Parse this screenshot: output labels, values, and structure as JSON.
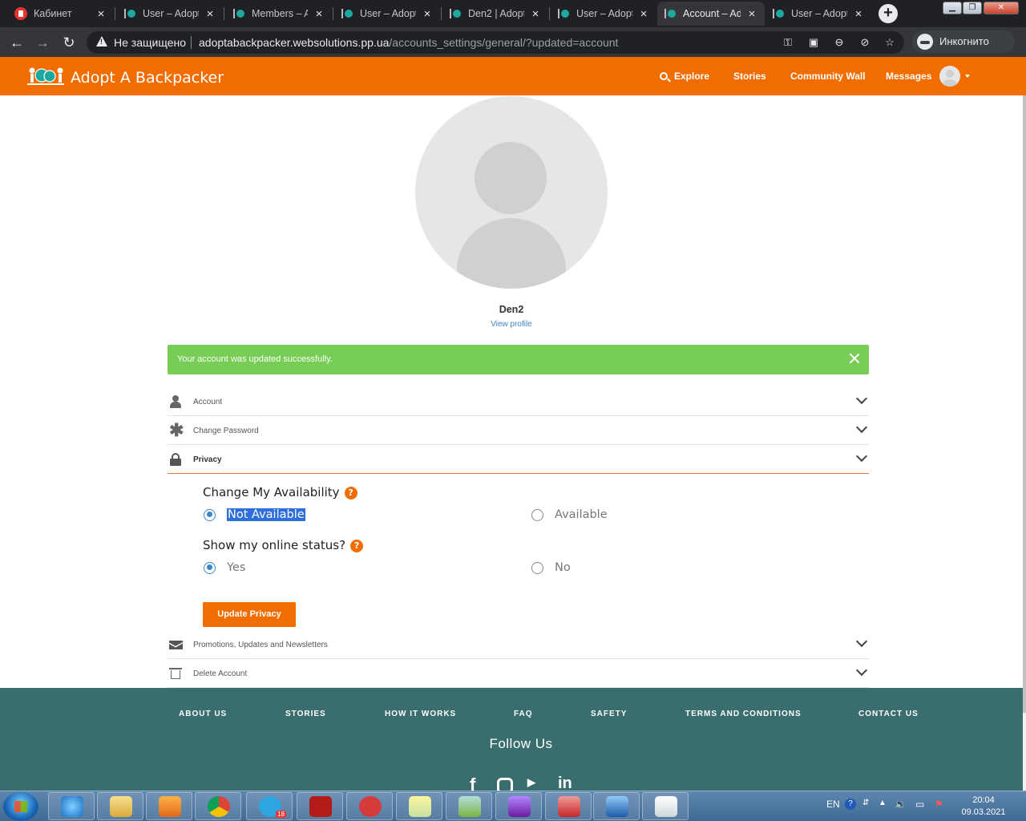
{
  "browser": {
    "tabs": [
      {
        "title": "Кабинет"
      },
      {
        "title": "User – Adopt"
      },
      {
        "title": "Members – A"
      },
      {
        "title": "User – Adopt"
      },
      {
        "title": "Den2 | Adopt"
      },
      {
        "title": "User – Adopt"
      },
      {
        "title": "Account – Ad"
      },
      {
        "title": "User – Adopt"
      }
    ],
    "security_label": "Не защищено",
    "url_host": "adoptabackpacker.websolutions.pp.ua",
    "url_path": "/accounts_settings/general/?updated=account",
    "incognito_label": "Инкогнито"
  },
  "site": {
    "name": "Adopt A Backpacker",
    "nav": {
      "explore": "Explore",
      "stories": "Stories",
      "community_wall": "Community Wall",
      "messages": "Messages"
    },
    "brand_color": "#f26d00"
  },
  "profile": {
    "name": "Den2",
    "view_profile": "View profile"
  },
  "alert": {
    "message": "Your account was updated successfully.",
    "color": "#77cd55"
  },
  "sections": {
    "account": "Account",
    "change_password": "Change Password",
    "privacy": "Privacy",
    "promotions": "Promotions, Updates and Newsletters",
    "delete_account": "Delete Account"
  },
  "privacy": {
    "availability_title": "Change My Availability",
    "availability_options": {
      "not_available": "Not Available",
      "available": "Available"
    },
    "availability_selected": "Not Available",
    "online_title": "Show my online status?",
    "online_options": {
      "yes": "Yes",
      "no": "No"
    },
    "online_selected": "Yes",
    "help_glyph": "?",
    "update_button": "Update Privacy"
  },
  "footer": {
    "links": {
      "about": "ABOUT US",
      "stories": "STORIES",
      "how": "HOW IT WORKS",
      "faq": "FAQ",
      "safety": "SAFETY",
      "terms": "TERMS AND CONDITIONS",
      "contact": "CONTACT US"
    },
    "follow_us": "Follow Us",
    "color": "#3a6e6e"
  },
  "taskbar": {
    "language": "EN",
    "time": "20:04",
    "date": "09.03.2021",
    "telegram_badge": "18"
  }
}
